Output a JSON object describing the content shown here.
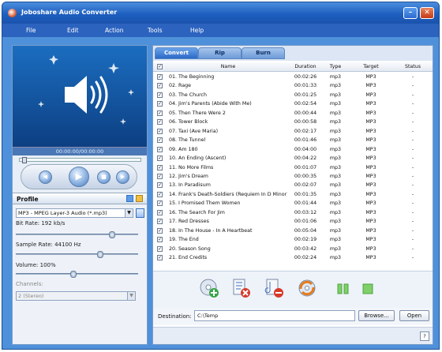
{
  "window": {
    "title": "Joboshare Audio Converter",
    "minimize": "–",
    "close": "✕"
  },
  "menu": [
    "File",
    "Edit",
    "Action",
    "Tools",
    "Help"
  ],
  "player": {
    "time": "00:00:00/00:00:00",
    "position": 0.02
  },
  "profile": {
    "heading": "Profile",
    "format": "MP3 - MPEG Layer-3 Audio  (*.mp3)",
    "bit_rate_label": "Bit Rate: 192 kb/s",
    "bit_rate_level": 0.8,
    "sample_rate_label": "Sample Rate: 44100 Hz",
    "sample_rate_level": 0.7,
    "volume_label": "Volume: 100%",
    "volume_level": 0.47,
    "channels_label": "Channels:",
    "channels_value": "2 (Stereo)"
  },
  "tabs": [
    "Convert",
    "Rip",
    "Burn"
  ],
  "table": {
    "columns": [
      "Name",
      "Duration",
      "Type",
      "Target",
      "Status"
    ],
    "rows": [
      [
        "01. The Beginning",
        "00:02:26",
        "mp3",
        "MP3",
        "-"
      ],
      [
        "02. Rage",
        "00:01:33",
        "mp3",
        "MP3",
        "-"
      ],
      [
        "03. The Church",
        "00:01:25",
        "mp3",
        "MP3",
        "-"
      ],
      [
        "04. Jim's Parents (Abide With Me)",
        "00:02:54",
        "mp3",
        "MP3",
        "-"
      ],
      [
        "05. Then There Were 2",
        "00:00:44",
        "mp3",
        "MP3",
        "-"
      ],
      [
        "06. Tower Block",
        "00:00:58",
        "mp3",
        "MP3",
        "-"
      ],
      [
        "07. Taxi (Ave Maria)",
        "00:02:17",
        "mp3",
        "MP3",
        "-"
      ],
      [
        "08. The Tunnel",
        "00:01:46",
        "mp3",
        "MP3",
        "-"
      ],
      [
        "09. Am 180",
        "00:04:00",
        "mp3",
        "MP3",
        "-"
      ],
      [
        "10. An Ending (Ascent)",
        "00:04:22",
        "mp3",
        "MP3",
        "-"
      ],
      [
        "11. No More Films",
        "00:01:07",
        "mp3",
        "MP3",
        "-"
      ],
      [
        "12. Jim's Dream",
        "00:00:35",
        "mp3",
        "MP3",
        "-"
      ],
      [
        "13. In Paradisum",
        "00:02:07",
        "mp3",
        "MP3",
        "-"
      ],
      [
        "14. Frank's Death-Soldiers (Requiem In D Minor)",
        "00:01:35",
        "mp3",
        "MP3",
        "-"
      ],
      [
        "15. I Promised Them Women",
        "00:01:44",
        "mp3",
        "MP3",
        "-"
      ],
      [
        "16. The Search For Jim",
        "00:03:12",
        "mp3",
        "MP3",
        "-"
      ],
      [
        "17. Red Dresses",
        "00:01:06",
        "mp3",
        "MP3",
        "-"
      ],
      [
        "18. In The House - In A Heartbeat",
        "00:05:04",
        "mp3",
        "MP3",
        "-"
      ],
      [
        "19. The End",
        "00:02:19",
        "mp3",
        "MP3",
        "-"
      ],
      [
        "20. Season Song",
        "00:03:42",
        "mp3",
        "MP3",
        "-"
      ],
      [
        "21. End Credits",
        "00:02:24",
        "mp3",
        "MP3",
        "-"
      ]
    ]
  },
  "destination": {
    "label": "Destination:",
    "value": "C:\\Temp",
    "browse": "Browse...",
    "open": "Open"
  },
  "help": "?"
}
